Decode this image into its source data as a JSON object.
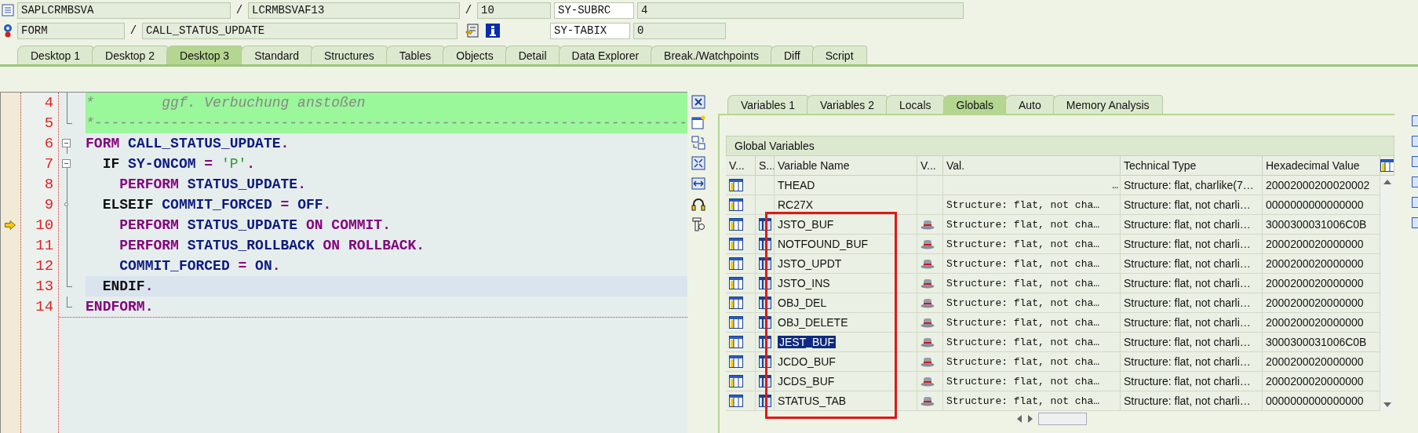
{
  "location": {
    "program": "SAPLCRMBSVA",
    "include": "LCRMBSVAF13",
    "line": "10",
    "event_type": "FORM",
    "event_name": "CALL_STATUS_UPDATE",
    "separators": [
      "/",
      "/",
      "/"
    ]
  },
  "system_fields": [
    {
      "name": "SY-SUBRC",
      "value": "4"
    },
    {
      "name": "SY-TABIX",
      "value": "0"
    }
  ],
  "desktop_tabs": [
    {
      "label": "Desktop 1",
      "selected": false
    },
    {
      "label": "Desktop 2",
      "selected": false
    },
    {
      "label": "Desktop 3",
      "selected": true
    },
    {
      "label": "Standard",
      "selected": false
    },
    {
      "label": "Structures",
      "selected": false
    },
    {
      "label": "Tables",
      "selected": false
    },
    {
      "label": "Objects",
      "selected": false
    },
    {
      "label": "Detail",
      "selected": false
    },
    {
      "label": "Data Explorer",
      "selected": false
    },
    {
      "label": "Break./Watchpoints",
      "selected": false
    },
    {
      "label": "Diff",
      "selected": false
    },
    {
      "label": "Script",
      "selected": false
    }
  ],
  "code_lines": [
    {
      "number": "4",
      "kind": "line",
      "comment": true,
      "execution_point": false,
      "highlighted": false,
      "tokens": [
        {
          "text": "*        ggf. Verbuchung anstoßen",
          "kind": "comment"
        }
      ]
    },
    {
      "number": "5",
      "kind": "end",
      "comment": true,
      "execution_point": false,
      "highlighted": false,
      "tokens": [
        {
          "text": "*----------------------------------------------------------------------",
          "kind": "comment"
        }
      ]
    },
    {
      "number": "6",
      "kind": "open",
      "comment": false,
      "execution_point": false,
      "highlighted": false,
      "tokens": [
        {
          "text": "FORM ",
          "kind": "keyword"
        },
        {
          "text": "CALL_STATUS_UPDATE",
          "kind": "name"
        },
        {
          "text": ".",
          "kind": "punct"
        }
      ]
    },
    {
      "number": "7",
      "kind": "open",
      "comment": false,
      "execution_point": false,
      "highlighted": false,
      "tokens": [
        {
          "text": "  IF ",
          "kind": "control"
        },
        {
          "text": "SY-ONCOM ",
          "kind": "name"
        },
        {
          "text": "= ",
          "kind": "punct"
        },
        {
          "text": "'P'",
          "kind": "string"
        },
        {
          "text": ".",
          "kind": "punct"
        }
      ]
    },
    {
      "number": "8",
      "kind": "line",
      "comment": false,
      "execution_point": false,
      "highlighted": false,
      "tokens": [
        {
          "text": "    PERFORM ",
          "kind": "keyword"
        },
        {
          "text": "STATUS_UPDATE",
          "kind": "name"
        },
        {
          "text": ".",
          "kind": "punct"
        }
      ]
    },
    {
      "number": "9",
      "kind": "branch",
      "comment": false,
      "execution_point": false,
      "highlighted": false,
      "tokens": [
        {
          "text": "  ELSEIF ",
          "kind": "control"
        },
        {
          "text": "COMMIT_FORCED ",
          "kind": "name"
        },
        {
          "text": "= ",
          "kind": "punct"
        },
        {
          "text": "OFF",
          "kind": "name"
        },
        {
          "text": ".",
          "kind": "punct"
        }
      ]
    },
    {
      "number": "10",
      "kind": "line",
      "comment": false,
      "execution_point": true,
      "highlighted": false,
      "tokens": [
        {
          "text": "    PERFORM ",
          "kind": "keyword"
        },
        {
          "text": "STATUS_UPDATE ",
          "kind": "name"
        },
        {
          "text": "ON COMMIT",
          "kind": "keyword"
        },
        {
          "text": ".",
          "kind": "punct"
        }
      ]
    },
    {
      "number": "11",
      "kind": "line",
      "comment": false,
      "execution_point": false,
      "highlighted": false,
      "tokens": [
        {
          "text": "    PERFORM ",
          "kind": "keyword"
        },
        {
          "text": "STATUS_ROLLBACK ",
          "kind": "name"
        },
        {
          "text": "ON ROLLBACK",
          "kind": "keyword"
        },
        {
          "text": ".",
          "kind": "punct"
        }
      ]
    },
    {
      "number": "12",
      "kind": "line",
      "comment": false,
      "execution_point": false,
      "highlighted": false,
      "tokens": [
        {
          "text": "    COMMIT_FORCED ",
          "kind": "name"
        },
        {
          "text": "= ",
          "kind": "punct"
        },
        {
          "text": "ON",
          "kind": "name"
        },
        {
          "text": ".",
          "kind": "punct"
        }
      ]
    },
    {
      "number": "13",
      "kind": "end",
      "comment": false,
      "execution_point": false,
      "highlighted": true,
      "tokens": [
        {
          "text": "  ENDIF",
          "kind": "control"
        },
        {
          "text": ".",
          "kind": "punct"
        }
      ]
    },
    {
      "number": "14",
      "kind": "end",
      "comment": false,
      "execution_point": false,
      "highlighted": false,
      "tokens": [
        {
          "text": "ENDFORM",
          "kind": "keyword"
        },
        {
          "text": ".",
          "kind": "punct"
        }
      ]
    }
  ],
  "variable_tabs": [
    {
      "label": "Variables 1",
      "selected": false
    },
    {
      "label": "Variables 2",
      "selected": false
    },
    {
      "label": "Locals",
      "selected": false
    },
    {
      "label": "Globals",
      "selected": true
    },
    {
      "label": "Auto",
      "selected": false
    },
    {
      "label": "Memory Analysis",
      "selected": false
    }
  ],
  "table": {
    "title": "Global Variables",
    "columns": [
      "V...",
      "S...",
      "Variable Name",
      "V...",
      "Val.",
      "Technical Type",
      "Hexadecimal Value"
    ],
    "rows": [
      {
        "name": "THEAD",
        "structure_icon": false,
        "value_icon": false,
        "value": "…",
        "technical_type": "Structure: flat, charlike(7…",
        "hex": "20002000200020002",
        "selected": false
      },
      {
        "name": "RC27X",
        "structure_icon": false,
        "value_icon": false,
        "value": "Structure: flat, not cha…",
        "technical_type": "Structure: flat, not charli…",
        "hex": "0000000000000000",
        "selected": false
      },
      {
        "name": "JSTO_BUF",
        "structure_icon": true,
        "value_icon": true,
        "value": "Structure: flat, not cha…",
        "technical_type": "Structure: flat, not charli…",
        "hex": "3000300031006C0B",
        "selected": false
      },
      {
        "name": "NOTFOUND_BUF",
        "structure_icon": true,
        "value_icon": true,
        "value": "Structure: flat, not cha…",
        "technical_type": "Structure: flat, not charli…",
        "hex": "2000200020000000",
        "selected": false
      },
      {
        "name": "JSTO_UPDT",
        "structure_icon": true,
        "value_icon": true,
        "value": "Structure: flat, not cha…",
        "technical_type": "Structure: flat, not charli…",
        "hex": "2000200020000000",
        "selected": false
      },
      {
        "name": "JSTO_INS",
        "structure_icon": true,
        "value_icon": true,
        "value": "Structure: flat, not cha…",
        "technical_type": "Structure: flat, not charli…",
        "hex": "2000200020000000",
        "selected": false
      },
      {
        "name": "OBJ_DEL",
        "structure_icon": true,
        "value_icon": true,
        "value": "Structure: flat, not cha…",
        "technical_type": "Structure: flat, not charli…",
        "hex": "2000200020000000",
        "selected": false
      },
      {
        "name": "OBJ_DELETE",
        "structure_icon": true,
        "value_icon": true,
        "value": "Structure: flat, not cha…",
        "technical_type": "Structure: flat, not charli…",
        "hex": "2000200020000000",
        "selected": false
      },
      {
        "name": "JEST_BUF",
        "structure_icon": true,
        "value_icon": true,
        "value": "Structure: flat, not cha…",
        "technical_type": "Structure: flat, not charli…",
        "hex": "3000300031006C0B",
        "selected": true
      },
      {
        "name": "JCDO_BUF",
        "structure_icon": true,
        "value_icon": true,
        "value": "Structure: flat, not cha…",
        "technical_type": "Structure: flat, not charli…",
        "hex": "2000200020000000",
        "selected": false
      },
      {
        "name": "JCDS_BUF",
        "structure_icon": true,
        "value_icon": true,
        "value": "Structure: flat, not cha…",
        "technical_type": "Structure: flat, not charli…",
        "hex": "2000200020000000",
        "selected": false
      },
      {
        "name": "STATUS_TAB",
        "structure_icon": true,
        "value_icon": true,
        "value": "Structure: flat, not cha…",
        "technical_type": "Structure: flat, not charli…",
        "hex": "0000000000000000",
        "selected": false
      }
    ]
  }
}
